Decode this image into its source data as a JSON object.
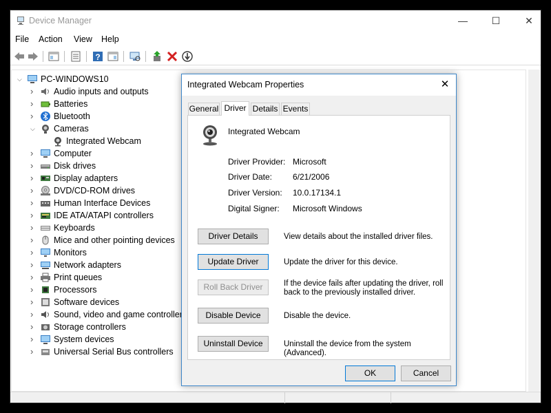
{
  "window": {
    "title": "Device Manager",
    "controls": {
      "minimize": "—",
      "maximize": "☐",
      "close": "✕"
    }
  },
  "menu": [
    "File",
    "Action",
    "View",
    "Help"
  ],
  "toolbar": {
    "icons": [
      "back-icon",
      "forward-icon",
      "show-hide-tree-icon",
      "properties-icon",
      "help-icon",
      "view-icon",
      "scan-hardware-icon",
      "update-driver-icon",
      "uninstall-icon",
      "disable-device-icon"
    ]
  },
  "tree": {
    "root": "PC-WINDOWS10",
    "categories": [
      {
        "label": "Audio inputs and outputs",
        "icon": "speaker-icon",
        "expanded": false
      },
      {
        "label": "Batteries",
        "icon": "battery-icon",
        "expanded": false
      },
      {
        "label": "Bluetooth",
        "icon": "bluetooth-icon",
        "expanded": false
      },
      {
        "label": "Cameras",
        "icon": "camera-icon",
        "expanded": true
      },
      {
        "label": "Integrated Webcam",
        "icon": "webcam-icon",
        "child": true
      },
      {
        "label": "Computer",
        "icon": "computer-icon",
        "expanded": false
      },
      {
        "label": "Disk drives",
        "icon": "disk-drive-icon",
        "expanded": false
      },
      {
        "label": "Display adapters",
        "icon": "display-adapter-icon",
        "expanded": false
      },
      {
        "label": "DVD/CD-ROM drives",
        "icon": "dvd-drive-icon",
        "expanded": false
      },
      {
        "label": "Human Interface Devices",
        "icon": "hid-icon",
        "expanded": false
      },
      {
        "label": "IDE ATA/ATAPI controllers",
        "icon": "ide-controller-icon",
        "expanded": false
      },
      {
        "label": "Keyboards",
        "icon": "keyboard-icon",
        "expanded": false
      },
      {
        "label": "Mice and other pointing devices",
        "icon": "mouse-icon",
        "expanded": false
      },
      {
        "label": "Monitors",
        "icon": "monitor-icon",
        "expanded": false
      },
      {
        "label": "Network adapters",
        "icon": "network-adapter-icon",
        "expanded": false
      },
      {
        "label": "Print queues",
        "icon": "printer-icon",
        "expanded": false
      },
      {
        "label": "Processors",
        "icon": "processor-icon",
        "expanded": false
      },
      {
        "label": "Software devices",
        "icon": "software-device-icon",
        "expanded": false
      },
      {
        "label": "Sound, video and game controllers",
        "icon": "sound-controller-icon",
        "expanded": false
      },
      {
        "label": "Storage controllers",
        "icon": "storage-controller-icon",
        "expanded": false
      },
      {
        "label": "System devices",
        "icon": "system-device-icon",
        "expanded": false
      },
      {
        "label": "Universal Serial Bus controllers",
        "icon": "usb-icon",
        "expanded": false
      }
    ]
  },
  "dialog": {
    "title": "Integrated Webcam Properties",
    "close": "✕",
    "tabs": [
      "General",
      "Driver",
      "Details",
      "Events"
    ],
    "active_tab": "Driver",
    "device_name": "Integrated Webcam",
    "properties": [
      {
        "label": "Driver Provider:",
        "value": "Microsoft"
      },
      {
        "label": "Driver Date:",
        "value": "6/21/2006"
      },
      {
        "label": "Driver Version:",
        "value": "10.0.17134.1"
      },
      {
        "label": "Digital Signer:",
        "value": "Microsoft Windows"
      }
    ],
    "actions": [
      {
        "button": "Driver Details",
        "description": "View details about the installed driver files.",
        "enabled": true
      },
      {
        "button": "Update Driver",
        "description": "Update the driver for this device.",
        "enabled": true
      },
      {
        "button": "Roll Back Driver",
        "description": "If the device fails after updating the driver, roll back to the previously installed driver.",
        "enabled": false
      },
      {
        "button": "Disable Device",
        "description": "Disable the device.",
        "enabled": true
      },
      {
        "button": "Uninstall Device",
        "description": "Uninstall the device from the system (Advanced).",
        "enabled": true
      }
    ],
    "ok_label": "OK",
    "cancel_label": "Cancel"
  },
  "colors": {
    "accent": "#0078d7",
    "dialog_border": "#3c86c9",
    "window_bg": "#ffffff",
    "dialog_bg": "#f0f0f0"
  }
}
